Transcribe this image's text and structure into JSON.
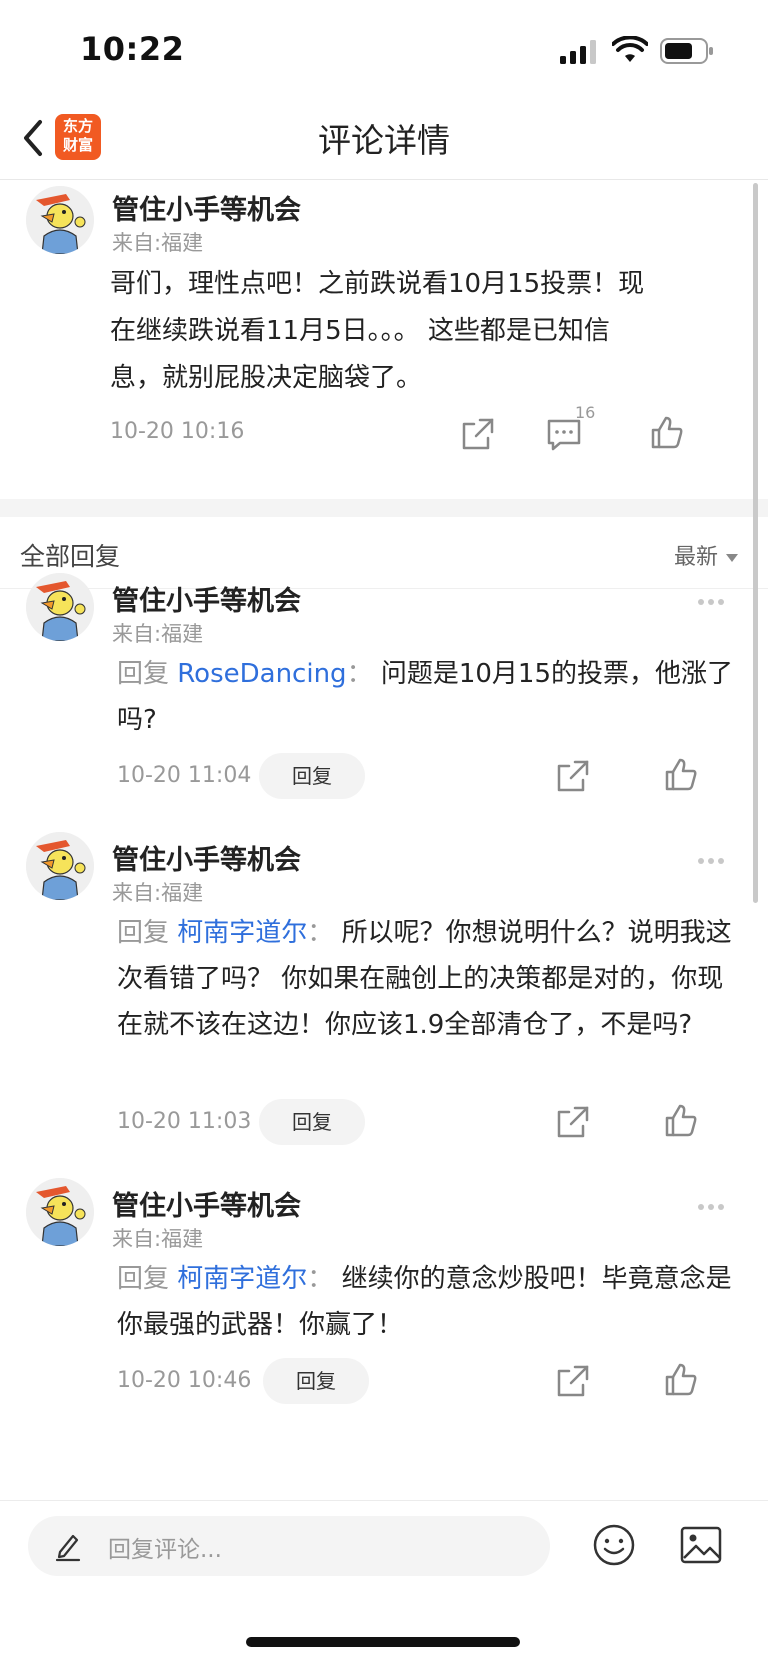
{
  "status_bar": {
    "time": "10:22"
  },
  "header": {
    "app_logo_text": "东方财富",
    "title": "评论详情"
  },
  "main_comment": {
    "username": "管住小手等机会",
    "location": "来自:福建",
    "text_lines": [
      "哥们，理性点吧！之前跌说看10月15投票！现",
      "在继续跌说看11月5日。。。 这些都是已知信",
      "息，就别屁股决定脑袋了。"
    ],
    "time": "10-20 10:16",
    "reply_count": "16"
  },
  "replies_section": {
    "title": "全部回复",
    "sort_label": "最新"
  },
  "replies": [
    {
      "username": "管住小手等机会",
      "location": "来自:福建",
      "reply_label": "回复",
      "reply_to": "RoseDancing",
      "colon": "：",
      "text": "问题是10月15的投票，他涨了吗?",
      "time": "10-20 11:04",
      "reply_button": "回复"
    },
    {
      "username": "管住小手等机会",
      "location": "来自:福建",
      "reply_label": "回复",
      "reply_to": "柯南字道尔",
      "colon": "：",
      "text": "所以呢？你想说明什么？说明我这次看错了吗？ 你如果在融创上的决策都是对的，你现在就不该在这边！你应该1.9全部清仓了，不是吗?",
      "time": "10-20 11:03",
      "reply_button": "回复"
    },
    {
      "username": "管住小手等机会",
      "location": "来自:福建",
      "reply_label": "回复",
      "reply_to": "柯南字道尔",
      "colon": "：",
      "text": "继续你的意念炒股吧！毕竟意念是你最强的武器！你赢了！",
      "time": "10-20 10:46",
      "reply_button": "回复"
    }
  ],
  "bottom_bar": {
    "input_placeholder": "回复评论..."
  },
  "colors": {
    "brand": "#f15a22",
    "link": "#2f6fdc",
    "muted": "#999999"
  },
  "icons": [
    "back-arrow-icon",
    "share-icon",
    "comment-icon",
    "like-icon",
    "more-dots-icon",
    "pen-icon",
    "emoji-icon",
    "image-icon",
    "avatar-cartoon-duck"
  ]
}
